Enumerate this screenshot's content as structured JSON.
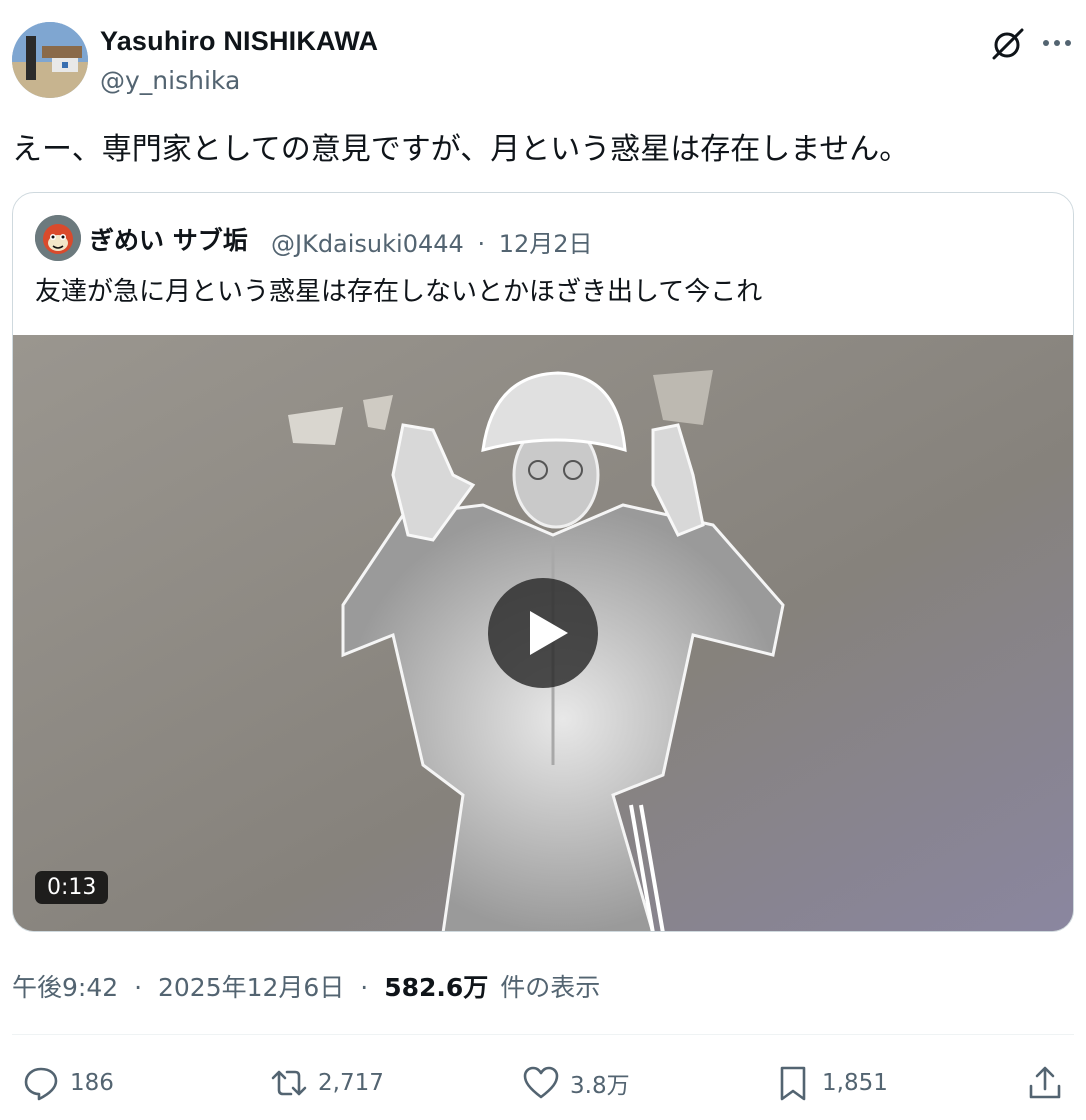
{
  "author": {
    "name": "Yasuhiro NISHIKAWA",
    "handle": "@y_nishika"
  },
  "tweet": {
    "text": "えー、専門家としての意見ですが、月という惑星は存在しません。"
  },
  "quoted": {
    "name": "ぎめい サブ垢",
    "handle": "@JKdaisuki0444",
    "separator": "·",
    "date": "12月2日",
    "text": "友達が急に月という惑星は存在しないとかほざき出して今これ",
    "video": {
      "duration": "0:13"
    }
  },
  "meta": {
    "time": "午後9:42",
    "sep1": "·",
    "date": "2025年12月6日",
    "sep2": "·",
    "views": "582.6万",
    "views_label": "件の表示"
  },
  "actions": {
    "replies": "186",
    "reposts": "2,717",
    "likes": "3.8万",
    "bookmarks": "1,851"
  }
}
